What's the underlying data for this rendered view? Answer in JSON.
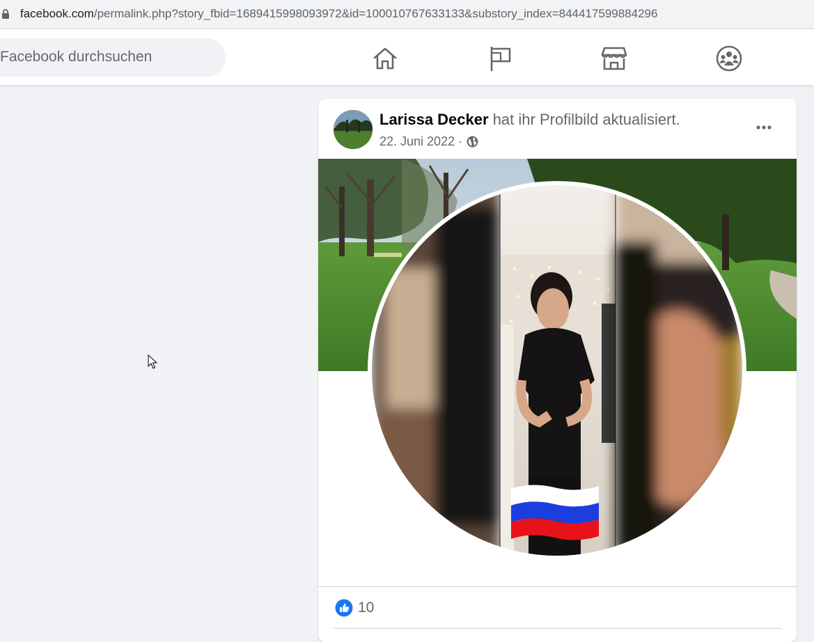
{
  "browser": {
    "url_host": "facebook.com",
    "url_path": "/permalink.php?story_fbid=1689415998093972&id=100010767633133&substory_index=844417599884296"
  },
  "topbar": {
    "search_placeholder": "Facebook durchsuchen",
    "nav": [
      "home-icon",
      "pages-flag-icon",
      "marketplace-icon",
      "groups-icon"
    ]
  },
  "post": {
    "author": "Larissa Decker",
    "action": "hat ihr Profilbild aktualisiert.",
    "date": "22. Juni 2022 ·",
    "privacy_icon": "globe-icon",
    "more_icon": "more-options-icon",
    "likes_count": "10"
  },
  "colors": {
    "background": "#f0f2f5",
    "card": "#ffffff",
    "like_blue": "#1877f2",
    "text_primary": "#050505",
    "text_secondary": "#65676b"
  }
}
